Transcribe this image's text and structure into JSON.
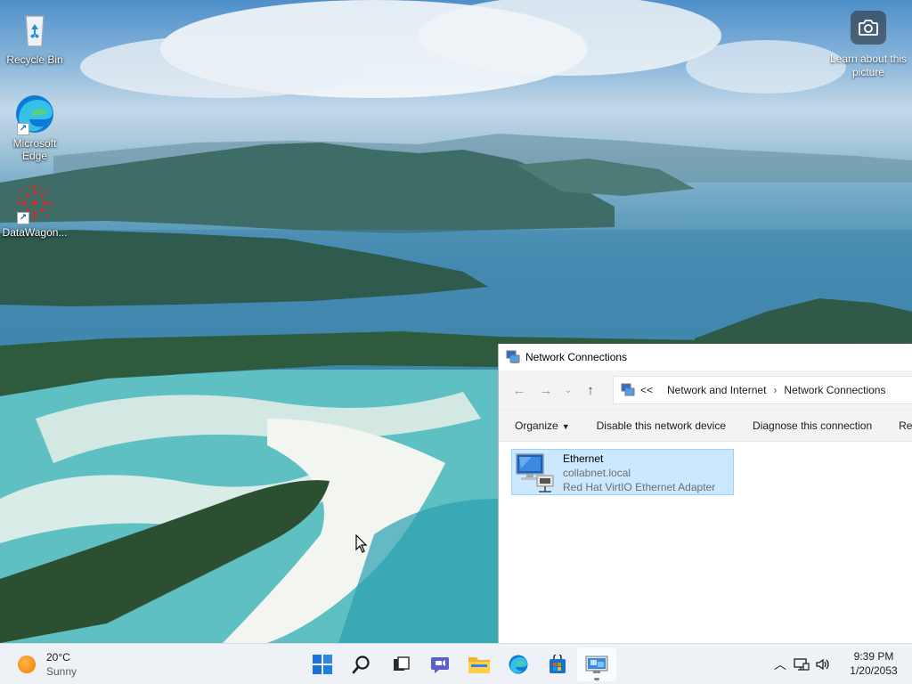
{
  "desktop": {
    "icons": [
      {
        "label": "Recycle Bin",
        "icon": "recycle-bin-icon"
      },
      {
        "label": "Microsoft Edge",
        "icon": "edge-icon"
      },
      {
        "label": "DataWagon...",
        "icon": "datawagon-icon"
      }
    ],
    "learn_about": {
      "label": "Learn about this picture",
      "icon": "camera-icon"
    }
  },
  "window": {
    "title": "Network Connections",
    "breadcrumb": {
      "overflow": "<<",
      "items": [
        "Network and Internet",
        "Network Connections"
      ]
    },
    "commands": {
      "organize": "Organize",
      "disable": "Disable this network device",
      "diagnose": "Diagnose this connection",
      "rename": "Ren"
    },
    "items": [
      {
        "name": "Ethernet",
        "network": "collabnet.local",
        "adapter": "Red Hat VirtIO Ethernet Adapter",
        "icon": "network-adapter-icon",
        "selected": true
      }
    ]
  },
  "taskbar": {
    "weather": {
      "temp": "20°C",
      "condition": "Sunny"
    },
    "apps": [
      "start-icon",
      "search-icon",
      "task-view-icon",
      "chat-icon",
      "file-explorer-icon",
      "edge-icon",
      "store-icon",
      "network-connections-icon"
    ],
    "active_app": "network-connections-icon",
    "clock": {
      "time": "9:39 PM",
      "date": "1/20/2053"
    }
  },
  "colors": {
    "selection_bg": "#cce8ff",
    "selection_border": "#99d1ff",
    "taskbar_bg": "#eef1f5",
    "window_chrome": "#f3f3f3"
  }
}
